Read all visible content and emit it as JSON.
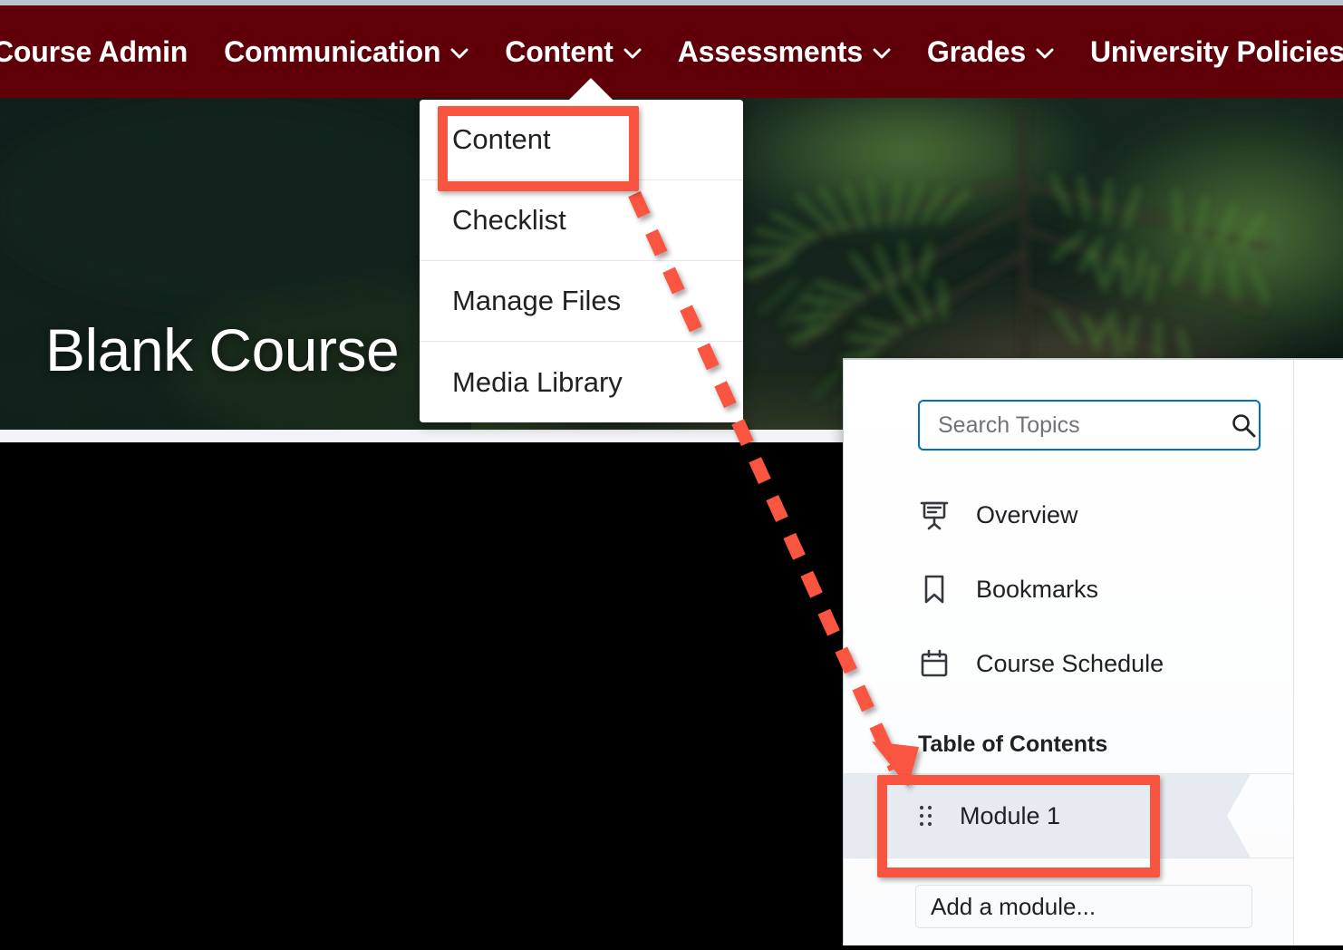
{
  "navbar": {
    "background": "#5f0009",
    "items": [
      {
        "label": "Course Admin",
        "has_chevron": false
      },
      {
        "label": "Communication",
        "has_chevron": true
      },
      {
        "label": "Content",
        "has_chevron": true
      },
      {
        "label": "Assessments",
        "has_chevron": true
      },
      {
        "label": "Grades",
        "has_chevron": true
      },
      {
        "label": "University Policies",
        "has_chevron": false
      }
    ]
  },
  "banner": {
    "course_title": "Blank Course"
  },
  "content_dropdown": {
    "items": [
      {
        "label": "Content"
      },
      {
        "label": "Checklist"
      },
      {
        "label": "Manage Files"
      },
      {
        "label": "Media Library"
      }
    ]
  },
  "topics_panel": {
    "search": {
      "placeholder": "Search Topics",
      "value": "",
      "icon": "search-icon",
      "focus_color": "#006fbf"
    },
    "links": [
      {
        "label": "Overview",
        "icon": "presentation-icon"
      },
      {
        "label": "Bookmarks",
        "icon": "bookmark-icon"
      },
      {
        "label": "Course Schedule",
        "icon": "calendar-icon"
      }
    ],
    "toc_heading": "Table of Contents",
    "modules": [
      {
        "label": "Module 1",
        "icon": "drag-handle-icon",
        "selected": true
      }
    ],
    "add_module_placeholder": "Add a module...",
    "selected_row_color": "#e6ebf2"
  },
  "annotations": {
    "highlight_color": "#f9543f",
    "boxes": [
      {
        "name": "content-menu-item-highlight",
        "target": "Content"
      },
      {
        "name": "module-1-highlight",
        "target": "Module 1"
      }
    ],
    "arrow": {
      "from": "Content",
      "to": "Module 1",
      "style": "dashed"
    }
  }
}
